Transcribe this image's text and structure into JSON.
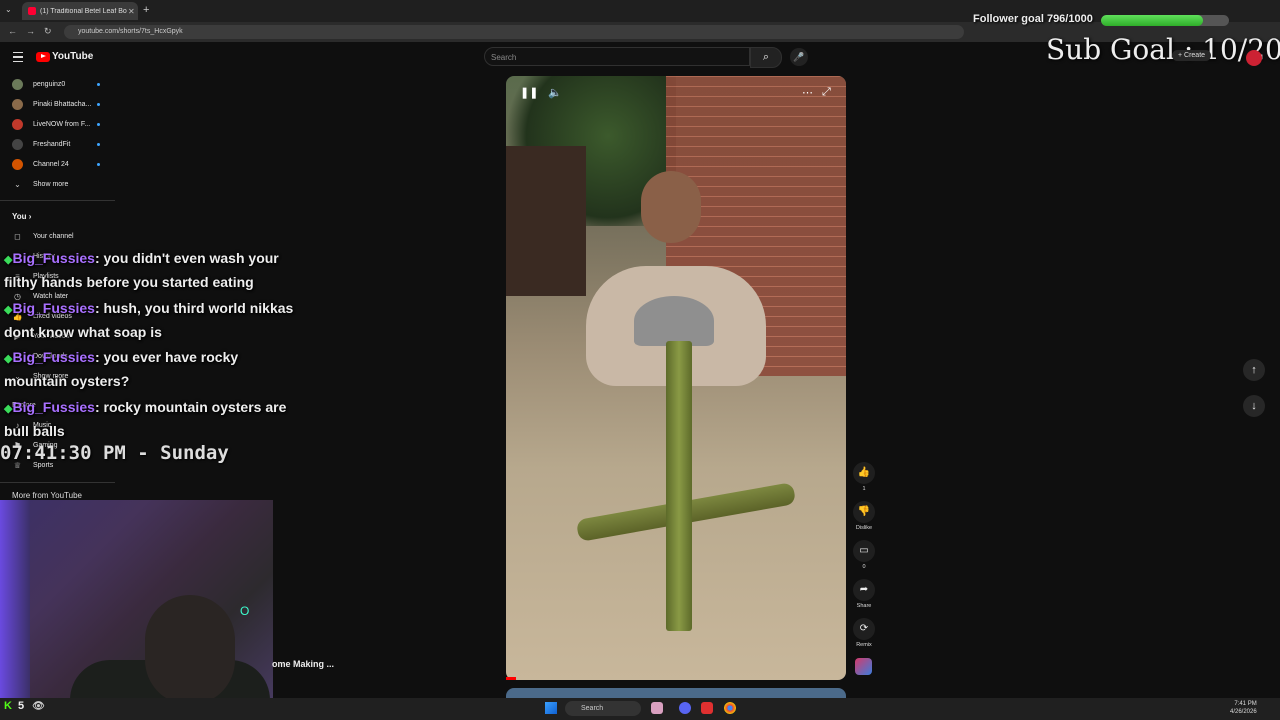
{
  "browser": {
    "tab_title": "(1) Traditional Betel Leaf Bo",
    "url": "youtube.com/shorts/7ts_HcxGpyk"
  },
  "youtube": {
    "logo_text": "YouTube",
    "search_placeholder": "Search",
    "create_label": "+ Create"
  },
  "sidebar": {
    "subscriptions": [
      {
        "label": "penguinz0",
        "color": "#6b7a5a"
      },
      {
        "label": "Pinaki Bhattacha...",
        "color": "#8a6a4a"
      },
      {
        "label": "LiveNOW from F...",
        "color": "#c0392b"
      },
      {
        "label": "FreshandFit",
        "color": "#444444"
      },
      {
        "label": "Channel 24",
        "color": "#d35400"
      }
    ],
    "show_more": "Show more",
    "you_heading": "You",
    "you_items": [
      {
        "label": "Your channel",
        "icon": "user-icon"
      },
      {
        "label": "History",
        "icon": "history-icon"
      },
      {
        "label": "Playlists",
        "icon": "playlist-icon"
      },
      {
        "label": "Watch later",
        "icon": "clock-icon"
      },
      {
        "label": "Liked videos",
        "icon": "thumb-up-icon"
      },
      {
        "label": "Your videos",
        "icon": "video-icon"
      },
      {
        "label": "Downloads",
        "icon": "download-icon"
      },
      {
        "label": "Show more",
        "icon": "chevron-down-icon"
      }
    ],
    "explore_heading": "Explore",
    "explore_items": [
      {
        "label": "Music",
        "icon": "music-icon"
      },
      {
        "label": "Gaming",
        "icon": "gaming-icon"
      },
      {
        "label": "Sports",
        "icon": "trophy-icon"
      }
    ],
    "more_from": "More from YouTube"
  },
  "chat": [
    {
      "user": "Big_Fussies",
      "text": ": you didn't even wash your filthy hands before you started eating"
    },
    {
      "user": "Big_Fussies",
      "text": ": hush, you third world nikkas dont know what soap is"
    },
    {
      "user": "Big_Fussies",
      "text": ": you ever have rocky mountain oysters?"
    },
    {
      "user": "Big_Fussies",
      "text": ": rocky mountain oysters are bull balls"
    }
  ],
  "clock": "07:41:30 PM - Sunday",
  "overlay": {
    "follower_goal": "Follower goal 796/1000",
    "follower_progress": 0.796,
    "sub_goal": "Sub Goal : 10/20"
  },
  "video_strip_title": "ome Making ...",
  "actions": [
    {
      "icon": "thumb-up-icon",
      "label": "1"
    },
    {
      "icon": "thumb-down-icon",
      "label": "Dislike"
    },
    {
      "icon": "comment-icon",
      "label": "0"
    },
    {
      "icon": "share-icon",
      "label": "Share"
    },
    {
      "icon": "remix-icon",
      "label": "Remix"
    }
  ],
  "kick": {
    "count": "5"
  },
  "taskbar": {
    "search": "Search",
    "time": "7:41 PM",
    "date": "4/26/2026"
  }
}
